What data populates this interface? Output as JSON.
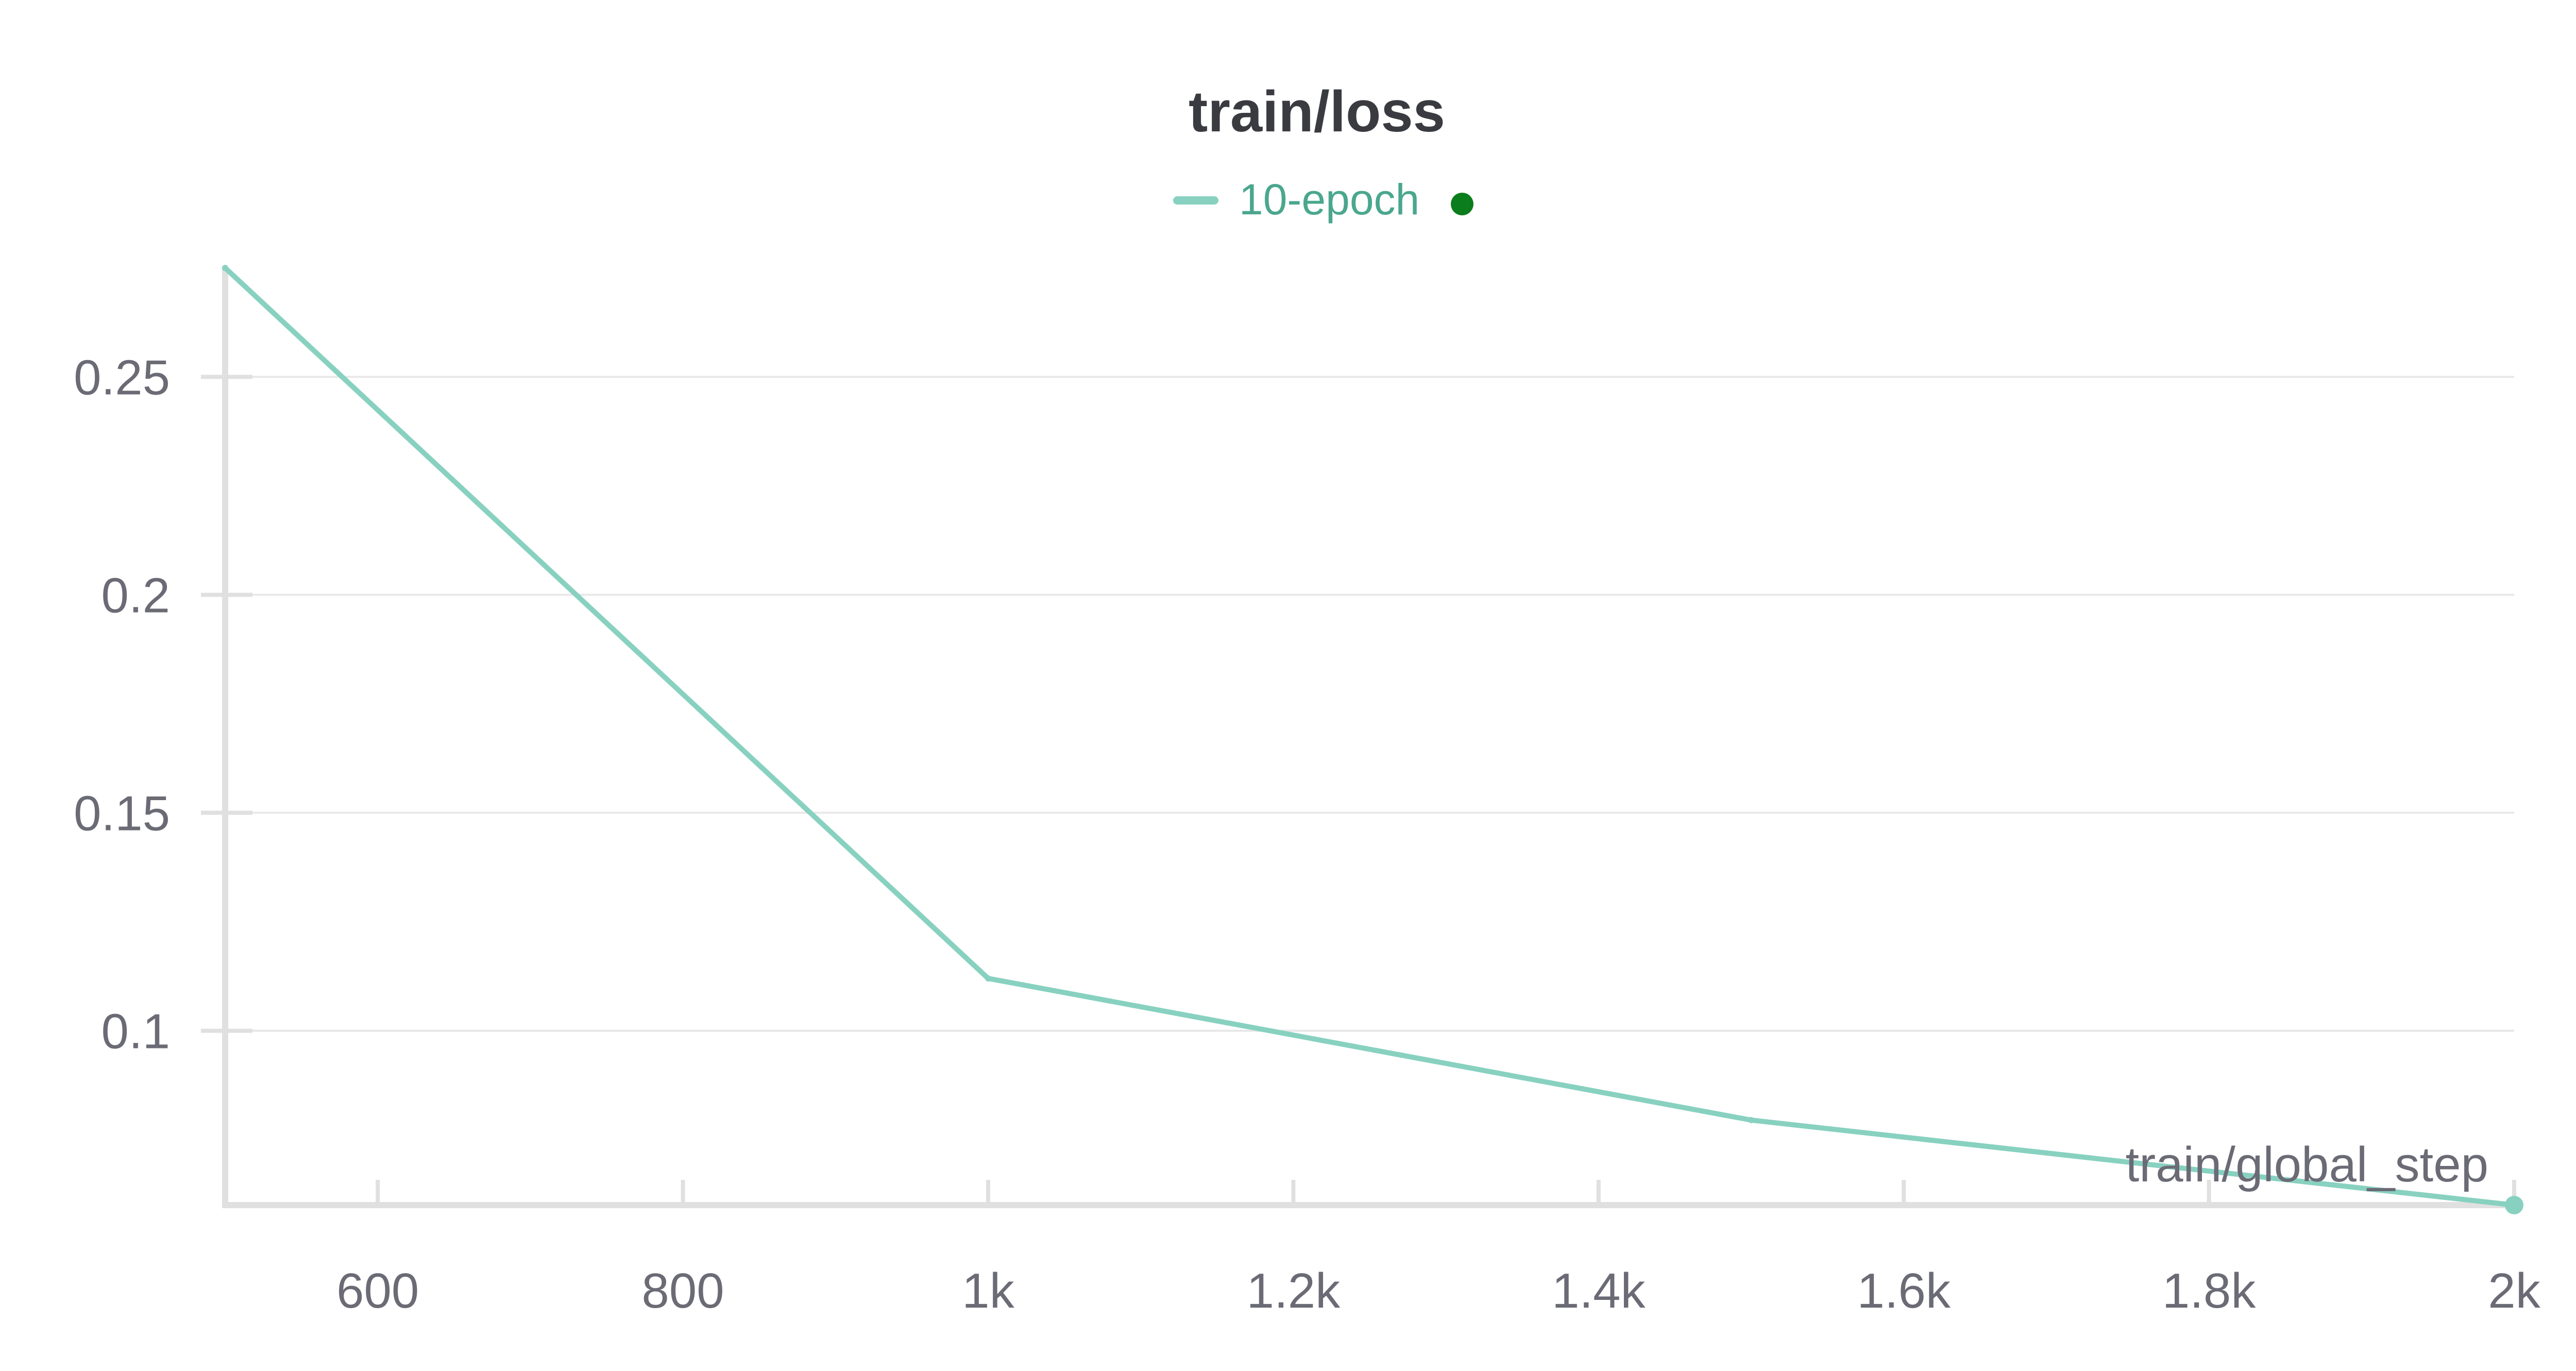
{
  "chart_data": {
    "type": "line",
    "title": "train/loss",
    "xlabel": "train/global_step",
    "ylabel": "",
    "xlim": [
      500,
      2000
    ],
    "ylim": [
      0.06,
      0.275
    ],
    "xticks": [
      {
        "value": 600,
        "label": "600"
      },
      {
        "value": 800,
        "label": "800"
      },
      {
        "value": 1000,
        "label": "1k"
      },
      {
        "value": 1200,
        "label": "1.2k"
      },
      {
        "value": 1400,
        "label": "1.4k"
      },
      {
        "value": 1600,
        "label": "1.6k"
      },
      {
        "value": 1800,
        "label": "1.8k"
      },
      {
        "value": 2000,
        "label": "2k"
      }
    ],
    "yticks": [
      {
        "value": 0.1,
        "label": "0.1"
      },
      {
        "value": 0.15,
        "label": "0.15"
      },
      {
        "value": 0.2,
        "label": "0.2"
      },
      {
        "value": 0.25,
        "label": "0.25"
      }
    ],
    "grid": true,
    "legend": "top-center",
    "series": [
      {
        "name": "10-epoch",
        "color": "#88d1c0",
        "x": [
          500,
          1000,
          1500,
          2000
        ],
        "y": [
          0.275,
          0.112,
          0.0795,
          0.06
        ]
      }
    ],
    "status_dot_color": "#0b7d1c",
    "label_color": "#6b6b76",
    "title_color": "#3a3b40",
    "legend_text_color": "#4aa78e"
  }
}
